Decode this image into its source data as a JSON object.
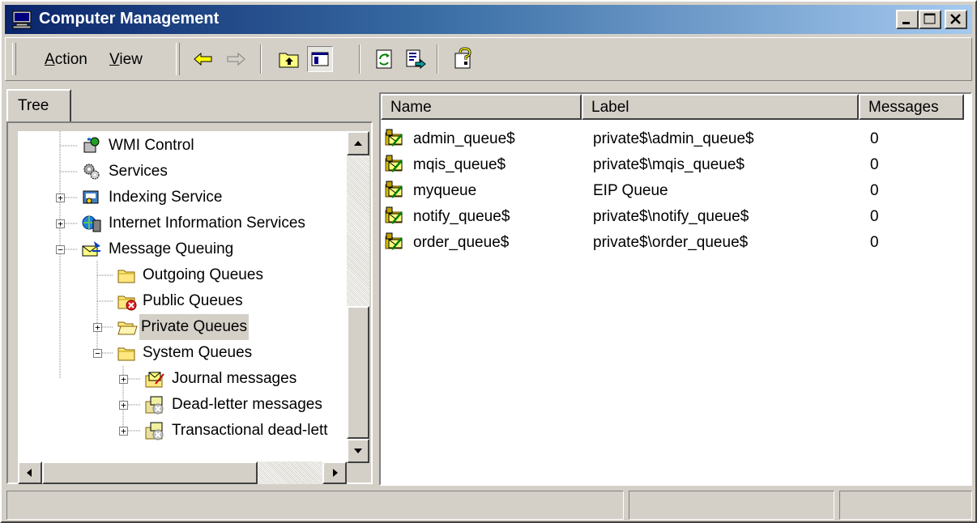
{
  "window": {
    "title": "Computer Management"
  },
  "menu": {
    "action_mn": "A",
    "action_rest": "ction",
    "view_mn": "V",
    "view_rest": "iew"
  },
  "toolbar": {
    "buttons": [
      "back-arrow-icon",
      "forward-arrow-icon",
      "up-one-level-icon",
      "show-hide-tree-icon",
      "refresh-icon",
      "export-list-icon",
      "help-icon"
    ]
  },
  "tree": {
    "tab_label": "Tree",
    "items": [
      {
        "label": "WMI Control",
        "icon": "wmi-control-icon",
        "expander": ""
      },
      {
        "label": "Services",
        "icon": "services-gears-icon",
        "expander": ""
      },
      {
        "label": "Indexing Service",
        "icon": "indexing-service-icon",
        "expander": "+"
      },
      {
        "label": "Internet Information Services",
        "icon": "iis-icon",
        "expander": "+"
      },
      {
        "label": "Message Queuing",
        "icon": "message-queuing-icon",
        "expander": "−"
      },
      {
        "label": "Outgoing Queues",
        "icon": "folder-icon",
        "expander": ""
      },
      {
        "label": "Public Queues",
        "icon": "folder-error-icon",
        "expander": ""
      },
      {
        "label": "Private Queues",
        "icon": "folder-open-icon",
        "expander": "+",
        "selected": true
      },
      {
        "label": "System Queues",
        "icon": "folder-icon",
        "expander": "−"
      },
      {
        "label": "Journal messages",
        "icon": "journal-queue-icon",
        "expander": "+"
      },
      {
        "label": "Dead-letter messages",
        "icon": "dead-letter-queue-icon",
        "expander": "+"
      },
      {
        "label": "Transactional dead-lett",
        "icon": "transactional-dead-letter-icon",
        "expander": "+"
      }
    ]
  },
  "list": {
    "columns": [
      "Name",
      "Label",
      "Messages"
    ],
    "rows": [
      {
        "name": "admin_queue$",
        "label": "private$\\admin_queue$",
        "messages": "0"
      },
      {
        "name": "mqis_queue$",
        "label": "private$\\mqis_queue$",
        "messages": "0"
      },
      {
        "name": "myqueue",
        "label": "EIP Queue",
        "messages": "0"
      },
      {
        "name": "notify_queue$",
        "label": "private$\\notify_queue$",
        "messages": "0"
      },
      {
        "name": "order_queue$",
        "label": "private$\\order_queue$",
        "messages": "0"
      }
    ]
  },
  "colors": {
    "titlebar_start": "#0a246a",
    "titlebar_end": "#a6caf0",
    "face": "#d4d0c8"
  }
}
